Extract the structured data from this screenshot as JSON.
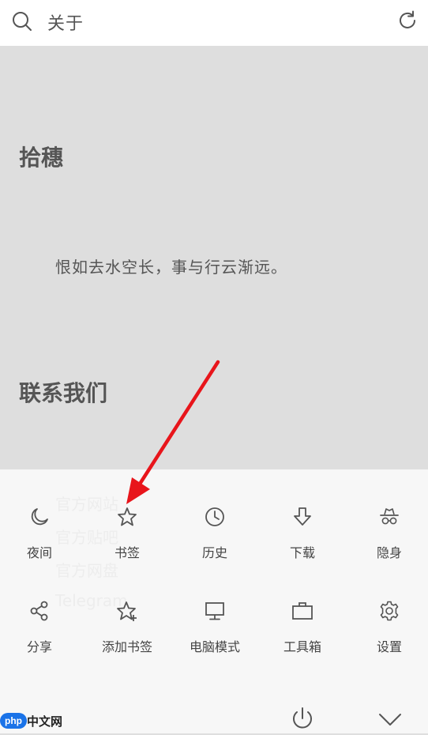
{
  "topbar": {
    "title": "关于"
  },
  "content": {
    "section1": "拾穗",
    "quote": "恨如去水空长，事与行云渐远。",
    "section2": "联系我们"
  },
  "background_links": [
    "官方网站",
    "官方贴吧",
    "官方网盘",
    "Telegram"
  ],
  "menu": {
    "row1": [
      {
        "label": "夜间",
        "icon": "moon-icon"
      },
      {
        "label": "书签",
        "icon": "star-icon"
      },
      {
        "label": "历史",
        "icon": "clock-icon"
      },
      {
        "label": "下载",
        "icon": "download-arrow-icon"
      },
      {
        "label": "隐身",
        "icon": "incognito-icon"
      }
    ],
    "row2": [
      {
        "label": "分享",
        "icon": "share-icon"
      },
      {
        "label": "添加书签",
        "icon": "star-plus-icon"
      },
      {
        "label": "电脑模式",
        "icon": "monitor-icon"
      },
      {
        "label": "工具箱",
        "icon": "toolbox-icon"
      },
      {
        "label": "设置",
        "icon": "gear-icon"
      }
    ]
  },
  "watermark": {
    "logo": "php",
    "text": "中文网"
  },
  "colors": {
    "arrow": "#e8151b",
    "page_bg": "#dedede",
    "panel_bg": "#f7f7f7"
  }
}
